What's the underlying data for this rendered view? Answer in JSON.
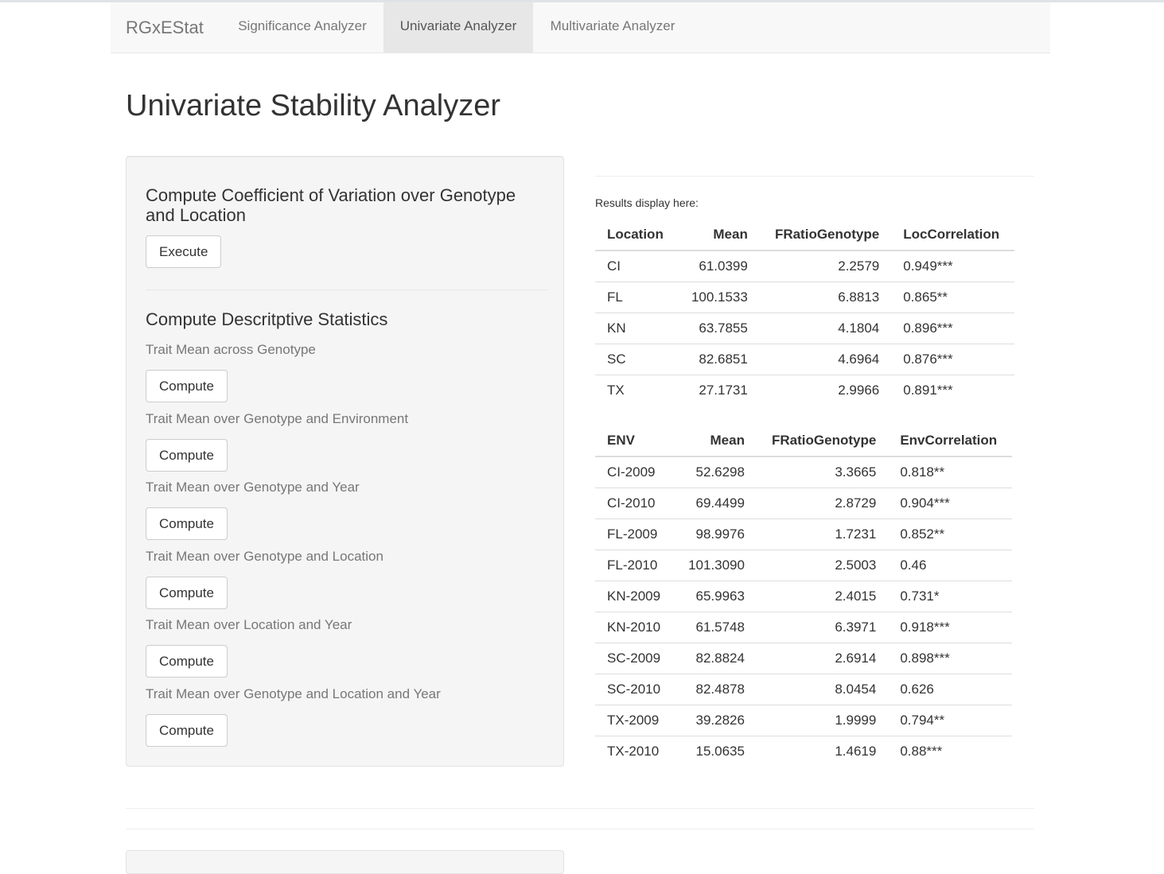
{
  "navbar": {
    "brand": "RGxEStat",
    "tabs": [
      {
        "label": "Significance Analyzer",
        "active": false
      },
      {
        "label": "Univariate Analyzer",
        "active": true
      },
      {
        "label": "Multivariate Analyzer",
        "active": false
      }
    ]
  },
  "page_title": "Univariate Stability Analyzer",
  "sidebar": {
    "cv_section": {
      "title": "Compute Coefficient of Variation over Genotype and Location",
      "button": "Execute"
    },
    "desc_section": {
      "title": "Compute Descritptive Statistics",
      "items": [
        {
          "label": "Trait Mean across Genotype",
          "button": "Compute"
        },
        {
          "label": "Trait Mean over Genotype and Environment",
          "button": "Compute"
        },
        {
          "label": "Trait Mean over Genotype and Year",
          "button": "Compute"
        },
        {
          "label": "Trait Mean over Genotype and Location",
          "button": "Compute"
        },
        {
          "label": "Trait Mean over Location and Year",
          "button": "Compute"
        },
        {
          "label": "Trait Mean over Genotype and Location and Year",
          "button": "Compute"
        }
      ]
    }
  },
  "results": {
    "label": "Results display here:",
    "location_table": {
      "headers": [
        "Location",
        "Mean",
        "FRatioGenotype",
        "LocCorrelation"
      ],
      "rows": [
        [
          "CI",
          "61.0399",
          "2.2579",
          "0.949***"
        ],
        [
          "FL",
          "100.1533",
          "6.8813",
          "0.865**"
        ],
        [
          "KN",
          "63.7855",
          "4.1804",
          "0.896***"
        ],
        [
          "SC",
          "82.6851",
          "4.6964",
          "0.876***"
        ],
        [
          "TX",
          "27.1731",
          "2.9966",
          "0.891***"
        ]
      ]
    },
    "env_table": {
      "headers": [
        "ENV",
        "Mean",
        "FRatioGenotype",
        "EnvCorrelation"
      ],
      "rows": [
        [
          "CI-2009",
          "52.6298",
          "3.3665",
          "0.818**"
        ],
        [
          "CI-2010",
          "69.4499",
          "2.8729",
          "0.904***"
        ],
        [
          "FL-2009",
          "98.9976",
          "1.7231",
          "0.852**"
        ],
        [
          "FL-2010",
          "101.3090",
          "2.5003",
          "0.46"
        ],
        [
          "KN-2009",
          "65.9963",
          "2.4015",
          "0.731*"
        ],
        [
          "KN-2010",
          "61.5748",
          "6.3971",
          "0.918***"
        ],
        [
          "SC-2009",
          "82.8824",
          "2.6914",
          "0.898***"
        ],
        [
          "SC-2010",
          "82.4878",
          "8.0454",
          "0.626"
        ],
        [
          "TX-2009",
          "39.2826",
          "1.9999",
          "0.794**"
        ],
        [
          "TX-2010",
          "15.0635",
          "1.4619",
          "0.88***"
        ]
      ]
    }
  }
}
